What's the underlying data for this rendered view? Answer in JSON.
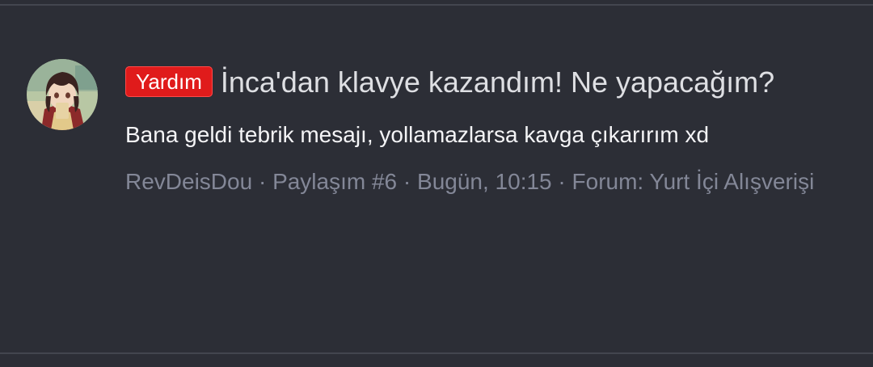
{
  "thread": {
    "prefix": "Yardım",
    "title": "İnca'dan klavye kazandım! Ne yapacağım?",
    "snippet": "Bana geldi tebrik mesajı, yollamazlarsa kavga çıkarırım xd",
    "author": "RevDeisDou",
    "separator": " · ",
    "post_number": "Paylaşım #6",
    "date": "Bugün, 10:15",
    "forum": "Forum: Yurt İçi Alışverişi"
  },
  "colors": {
    "background": "#2c2e36",
    "prefix_badge": "#e01b1b",
    "meta_text": "#838797",
    "title_text": "#dedfe3"
  }
}
